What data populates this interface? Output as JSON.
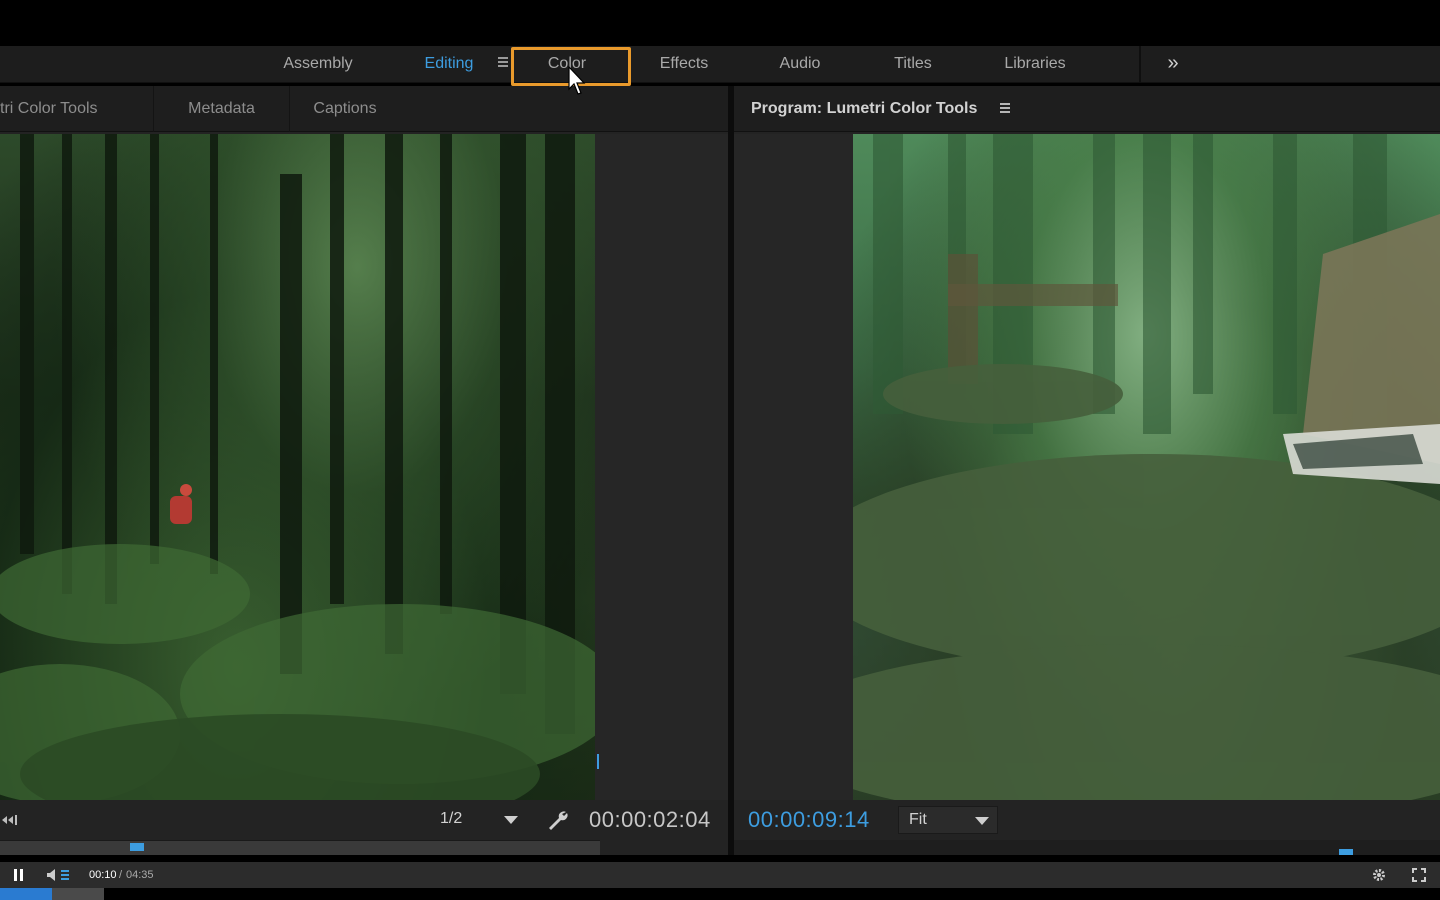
{
  "workspace": {
    "items": [
      {
        "label": "Assembly",
        "active": false
      },
      {
        "label": "Editing",
        "active": true
      },
      {
        "label": "Color",
        "active": false,
        "highlighted": true
      },
      {
        "label": "Effects",
        "active": false
      },
      {
        "label": "Audio",
        "active": false
      },
      {
        "label": "Titles",
        "active": false
      },
      {
        "label": "Libraries",
        "active": false
      }
    ],
    "overflow_label": "»"
  },
  "left_panel": {
    "tabs": [
      "tri Color Tools",
      "Metadata",
      "Captions"
    ],
    "resolution": "1/2",
    "timecode": "00:00:02:04"
  },
  "right_panel": {
    "title": "Program: Lumetri Color Tools",
    "timecode": "00:00:09:14",
    "zoom": "Fit"
  },
  "player": {
    "current_time": "00:10",
    "separator": " / ",
    "duration": "04:35",
    "progress_fraction": 0.036
  },
  "colors": {
    "accent": "#3d9de0",
    "highlight": "#e99a2c",
    "progress": "#2a7bd1"
  }
}
